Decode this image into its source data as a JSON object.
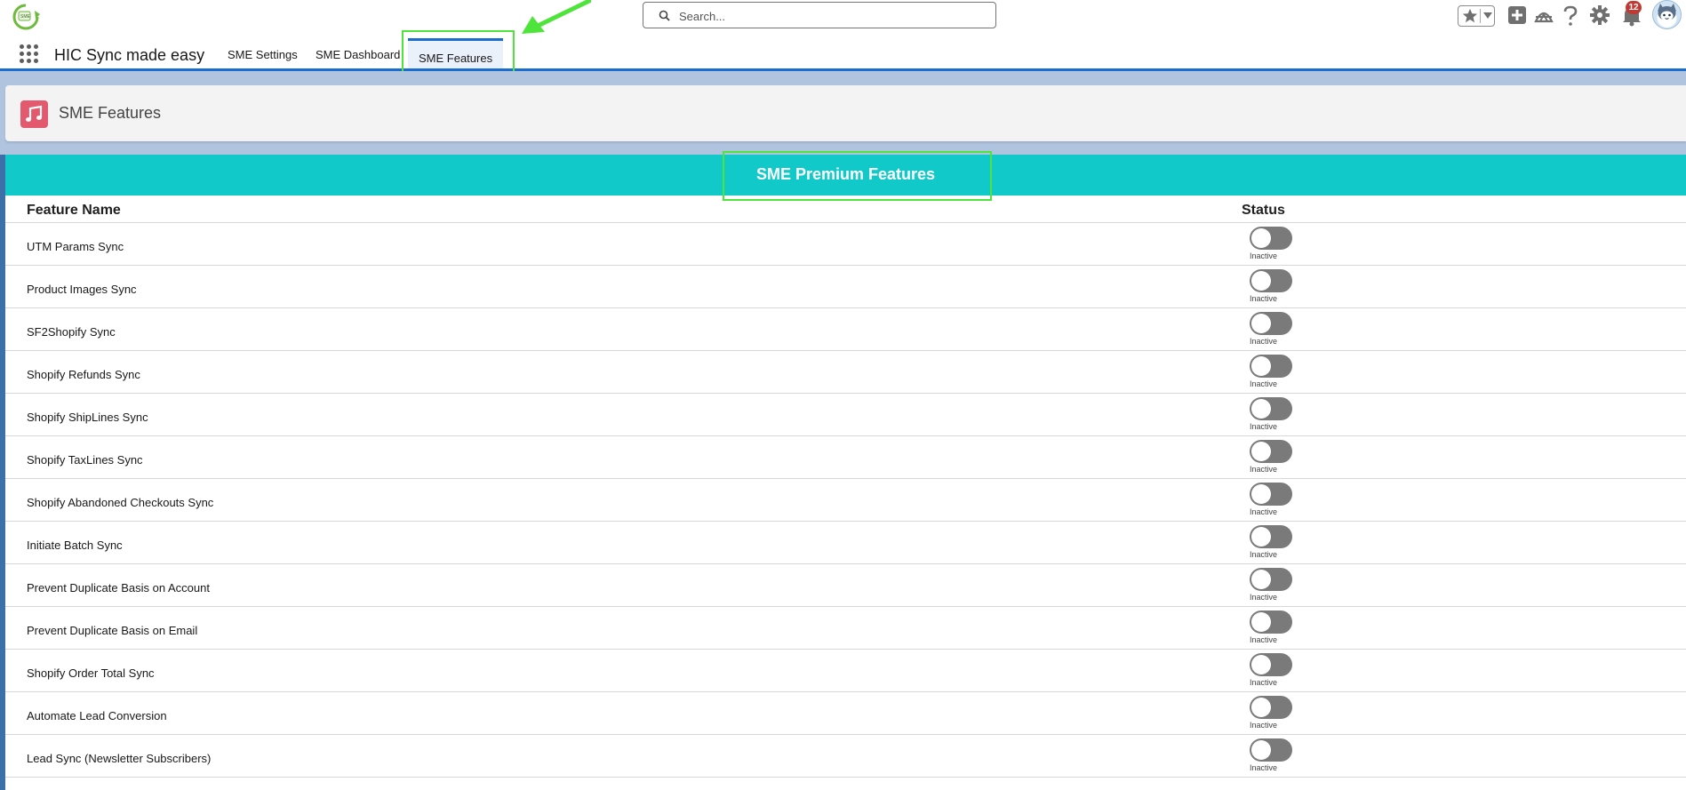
{
  "header": {
    "search_placeholder": "Search...",
    "notifications_count": "12",
    "icons": [
      "favorites-star-icon",
      "add-icon",
      "trailhead-icon",
      "help-icon",
      "setup-gear-icon",
      "notifications-bell-icon",
      "user-avatar"
    ]
  },
  "nav": {
    "app_name": "HIC Sync made easy",
    "tabs": [
      {
        "label": "SME Settings"
      },
      {
        "label": "SME Dashboard"
      },
      {
        "label": "SME Features"
      }
    ],
    "active_tab": "SME Features"
  },
  "page": {
    "title": "SME Features"
  },
  "features": {
    "banner_title": "SME Premium Features",
    "col_name": "Feature Name",
    "col_status": "Status",
    "rows": [
      {
        "name": "UTM Params Sync",
        "status": "Inactive"
      },
      {
        "name": "Product Images Sync",
        "status": "Inactive"
      },
      {
        "name": "SF2Shopify Sync",
        "status": "Inactive"
      },
      {
        "name": "Shopify Refunds Sync",
        "status": "Inactive"
      },
      {
        "name": "Shopify ShipLines Sync",
        "status": "Inactive"
      },
      {
        "name": "Shopify TaxLines Sync",
        "status": "Inactive"
      },
      {
        "name": "Shopify Abandoned Checkouts Sync",
        "status": "Inactive"
      },
      {
        "name": "Initiate Batch Sync",
        "status": "Inactive"
      },
      {
        "name": "Prevent Duplicate Basis on Account",
        "status": "Inactive"
      },
      {
        "name": "Prevent Duplicate Basis on Email",
        "status": "Inactive"
      },
      {
        "name": "Shopify Order Total Sync",
        "status": "Inactive"
      },
      {
        "name": "Automate Lead Conversion",
        "status": "Inactive"
      },
      {
        "name": "Lead Sync (Newsletter Subscribers)",
        "status": "Inactive"
      }
    ]
  },
  "colors": {
    "banner": "#12c9c9",
    "brand_blue": "#1b6ccf",
    "highlight_green": "#4fe43b",
    "toggle_off": "#7a7a7a",
    "page_icon": "#e3596e"
  }
}
